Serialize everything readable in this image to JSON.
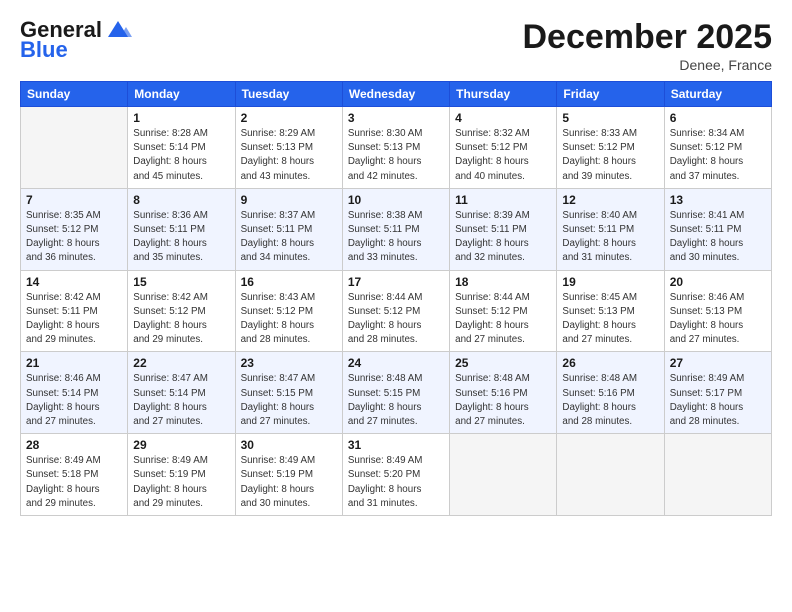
{
  "header": {
    "logo_line1": "General",
    "logo_line2": "Blue",
    "month": "December 2025",
    "location": "Denee, France"
  },
  "weekdays": [
    "Sunday",
    "Monday",
    "Tuesday",
    "Wednesday",
    "Thursday",
    "Friday",
    "Saturday"
  ],
  "weeks": [
    [
      {
        "day": "",
        "info": ""
      },
      {
        "day": "1",
        "info": "Sunrise: 8:28 AM\nSunset: 5:14 PM\nDaylight: 8 hours\nand 45 minutes."
      },
      {
        "day": "2",
        "info": "Sunrise: 8:29 AM\nSunset: 5:13 PM\nDaylight: 8 hours\nand 43 minutes."
      },
      {
        "day": "3",
        "info": "Sunrise: 8:30 AM\nSunset: 5:13 PM\nDaylight: 8 hours\nand 42 minutes."
      },
      {
        "day": "4",
        "info": "Sunrise: 8:32 AM\nSunset: 5:12 PM\nDaylight: 8 hours\nand 40 minutes."
      },
      {
        "day": "5",
        "info": "Sunrise: 8:33 AM\nSunset: 5:12 PM\nDaylight: 8 hours\nand 39 minutes."
      },
      {
        "day": "6",
        "info": "Sunrise: 8:34 AM\nSunset: 5:12 PM\nDaylight: 8 hours\nand 37 minutes."
      }
    ],
    [
      {
        "day": "7",
        "info": "Sunrise: 8:35 AM\nSunset: 5:12 PM\nDaylight: 8 hours\nand 36 minutes."
      },
      {
        "day": "8",
        "info": "Sunrise: 8:36 AM\nSunset: 5:11 PM\nDaylight: 8 hours\nand 35 minutes."
      },
      {
        "day": "9",
        "info": "Sunrise: 8:37 AM\nSunset: 5:11 PM\nDaylight: 8 hours\nand 34 minutes."
      },
      {
        "day": "10",
        "info": "Sunrise: 8:38 AM\nSunset: 5:11 PM\nDaylight: 8 hours\nand 33 minutes."
      },
      {
        "day": "11",
        "info": "Sunrise: 8:39 AM\nSunset: 5:11 PM\nDaylight: 8 hours\nand 32 minutes."
      },
      {
        "day": "12",
        "info": "Sunrise: 8:40 AM\nSunset: 5:11 PM\nDaylight: 8 hours\nand 31 minutes."
      },
      {
        "day": "13",
        "info": "Sunrise: 8:41 AM\nSunset: 5:11 PM\nDaylight: 8 hours\nand 30 minutes."
      }
    ],
    [
      {
        "day": "14",
        "info": "Sunrise: 8:42 AM\nSunset: 5:11 PM\nDaylight: 8 hours\nand 29 minutes."
      },
      {
        "day": "15",
        "info": "Sunrise: 8:42 AM\nSunset: 5:12 PM\nDaylight: 8 hours\nand 29 minutes."
      },
      {
        "day": "16",
        "info": "Sunrise: 8:43 AM\nSunset: 5:12 PM\nDaylight: 8 hours\nand 28 minutes."
      },
      {
        "day": "17",
        "info": "Sunrise: 8:44 AM\nSunset: 5:12 PM\nDaylight: 8 hours\nand 28 minutes."
      },
      {
        "day": "18",
        "info": "Sunrise: 8:44 AM\nSunset: 5:12 PM\nDaylight: 8 hours\nand 27 minutes."
      },
      {
        "day": "19",
        "info": "Sunrise: 8:45 AM\nSunset: 5:13 PM\nDaylight: 8 hours\nand 27 minutes."
      },
      {
        "day": "20",
        "info": "Sunrise: 8:46 AM\nSunset: 5:13 PM\nDaylight: 8 hours\nand 27 minutes."
      }
    ],
    [
      {
        "day": "21",
        "info": "Sunrise: 8:46 AM\nSunset: 5:14 PM\nDaylight: 8 hours\nand 27 minutes."
      },
      {
        "day": "22",
        "info": "Sunrise: 8:47 AM\nSunset: 5:14 PM\nDaylight: 8 hours\nand 27 minutes."
      },
      {
        "day": "23",
        "info": "Sunrise: 8:47 AM\nSunset: 5:15 PM\nDaylight: 8 hours\nand 27 minutes."
      },
      {
        "day": "24",
        "info": "Sunrise: 8:48 AM\nSunset: 5:15 PM\nDaylight: 8 hours\nand 27 minutes."
      },
      {
        "day": "25",
        "info": "Sunrise: 8:48 AM\nSunset: 5:16 PM\nDaylight: 8 hours\nand 27 minutes."
      },
      {
        "day": "26",
        "info": "Sunrise: 8:48 AM\nSunset: 5:16 PM\nDaylight: 8 hours\nand 28 minutes."
      },
      {
        "day": "27",
        "info": "Sunrise: 8:49 AM\nSunset: 5:17 PM\nDaylight: 8 hours\nand 28 minutes."
      }
    ],
    [
      {
        "day": "28",
        "info": "Sunrise: 8:49 AM\nSunset: 5:18 PM\nDaylight: 8 hours\nand 29 minutes."
      },
      {
        "day": "29",
        "info": "Sunrise: 8:49 AM\nSunset: 5:19 PM\nDaylight: 8 hours\nand 29 minutes."
      },
      {
        "day": "30",
        "info": "Sunrise: 8:49 AM\nSunset: 5:19 PM\nDaylight: 8 hours\nand 30 minutes."
      },
      {
        "day": "31",
        "info": "Sunrise: 8:49 AM\nSunset: 5:20 PM\nDaylight: 8 hours\nand 31 minutes."
      },
      {
        "day": "",
        "info": ""
      },
      {
        "day": "",
        "info": ""
      },
      {
        "day": "",
        "info": ""
      }
    ]
  ]
}
